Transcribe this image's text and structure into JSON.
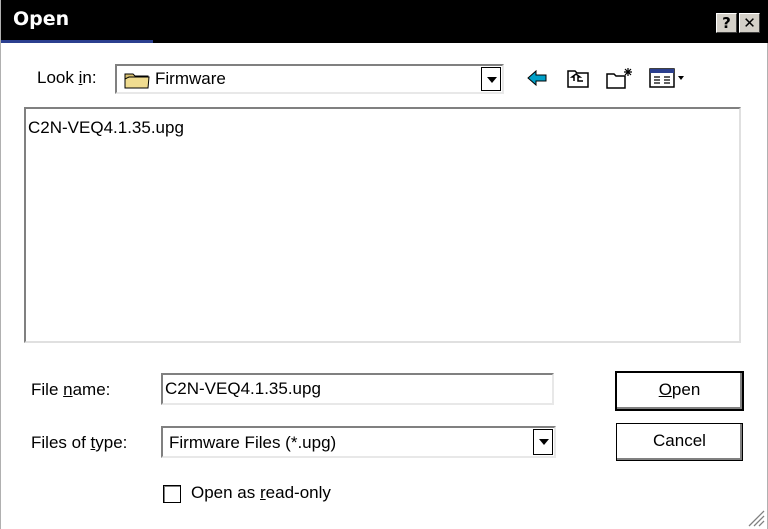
{
  "window": {
    "title": "Open",
    "help_button": "?",
    "close_button": "✕"
  },
  "look_in": {
    "label_pre": "Look ",
    "label_mnemonic": "i",
    "label_post": "n:",
    "value": "Firmware",
    "icon": "folder-icon"
  },
  "toolbar": {
    "back_icon": "back-arrow-icon",
    "up_icon": "up-one-level-icon",
    "new_folder_icon": "new-folder-icon",
    "view_menu_icon": "view-menu-icon"
  },
  "file_list": {
    "items": [
      "C2N-VEQ4.1.35.upg"
    ]
  },
  "file_name": {
    "label_pre": "File ",
    "label_mnemonic": "n",
    "label_post": "ame:",
    "value": "C2N-VEQ4.1.35.upg"
  },
  "file_type": {
    "label_pre": "Files of ",
    "label_mnemonic": "t",
    "label_post": "ype:",
    "value": "Firmware Files (*.upg)"
  },
  "buttons": {
    "open_mnemonic": "O",
    "open_rest": "pen",
    "cancel": "Cancel"
  },
  "read_only": {
    "label_pre": "Open as ",
    "label_mnemonic": "r",
    "label_post": "ead-only",
    "checked": false
  },
  "colors": {
    "titlebar": "#000000",
    "accent": "#2b3f8f",
    "folder": "#d8c070"
  }
}
